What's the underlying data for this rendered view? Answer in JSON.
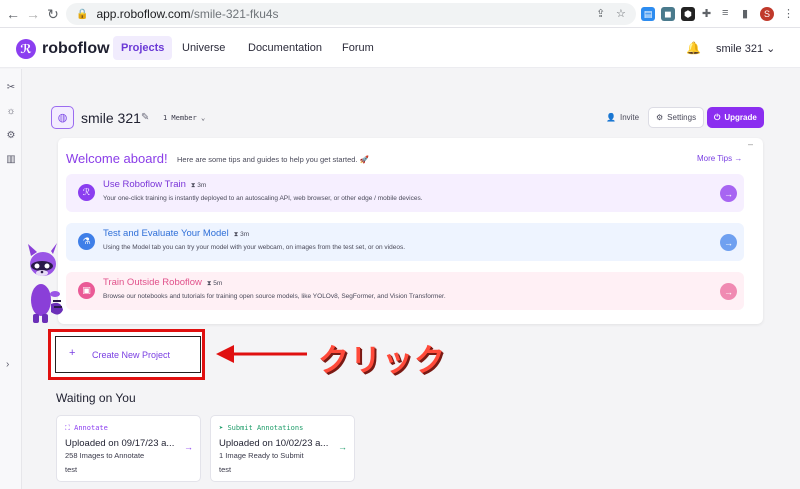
{
  "browser": {
    "url_host": "app.roboflow.com",
    "url_path": "/smile-321-fku4s",
    "profile_initial": "S"
  },
  "nav": {
    "brand": "roboflow",
    "links": [
      "Projects",
      "Universe",
      "Documentation",
      "Forum"
    ],
    "user": "smile 321"
  },
  "workspace": {
    "name": "smile 321",
    "members": "1 Member",
    "invite_label": "Invite",
    "settings_label": "Settings",
    "upgrade_label": "Upgrade"
  },
  "welcome": {
    "title": "Welcome aboard!",
    "subtitle": "Here are some tips and guides to help you get started.",
    "more_tips": "More Tips",
    "tips": [
      {
        "title": "Use Roboflow Train",
        "time": "3m",
        "desc": "Your one-click training is instantly deployed to an autoscaling API, web browser, or other edge / mobile devices.",
        "accent": "#8b3ef0",
        "bg": "#f6efff"
      },
      {
        "title": "Test and Evaluate Your Model",
        "time": "3m",
        "desc": "Using the Model tab you can try your model with your webcam, on images from the test set, or on videos.",
        "accent": "#3f7fe8",
        "bg": "#eef4ff"
      },
      {
        "title": "Train Outside Roboflow",
        "time": "5m",
        "desc": "Browse our notebooks and tutorials for training open source models, like YOLOv8, SegFormer, and Vision Transformer.",
        "accent": "#ea5a96",
        "bg": "#fff0f5"
      }
    ]
  },
  "create_project": {
    "label": "Create New Project"
  },
  "annotation_text": "クリック",
  "waiting": {
    "title": "Waiting on You",
    "cards": [
      {
        "type": "Annotate",
        "upload": "Uploaded on 09/17/23 a...",
        "count": "258 Images to Annotate",
        "project": "test",
        "color": "#8b3ef0"
      },
      {
        "type": "Submit Annotations",
        "upload": "Uploaded on 10/02/23 a...",
        "count": "1 Image Ready to Submit",
        "project": "test",
        "color": "#1f9d6a"
      }
    ]
  },
  "colors": {
    "accent": "#8b2ef0",
    "highlight": "#e01010",
    "annotation": "#ff4a3a"
  }
}
